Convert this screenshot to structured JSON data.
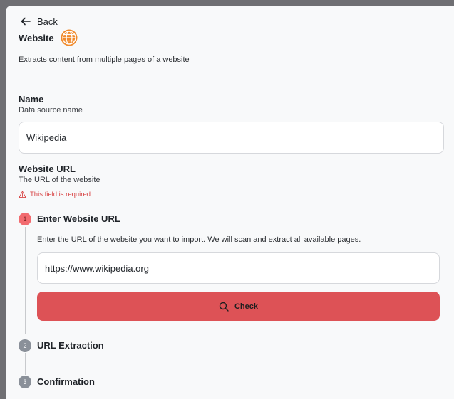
{
  "back_label": "Back",
  "header": {
    "title": "Website",
    "description": "Extracts content from multiple pages of a website"
  },
  "name_field": {
    "label": "Name",
    "sublabel": "Data source name",
    "value": "Wikipedia"
  },
  "url_field": {
    "label": "Website URL",
    "sublabel": "The URL of the website",
    "error": "This field is required"
  },
  "steps": [
    {
      "number": "1",
      "label": "Enter Website URL",
      "description": "Enter the URL of the website you want to import. We will scan and extract all available pages.",
      "input_value": "https://www.wikipedia.org",
      "button_label": "Check"
    },
    {
      "number": "2",
      "label": "URL Extraction"
    },
    {
      "number": "3",
      "label": "Confirmation"
    }
  ],
  "colors": {
    "accent": "#dd5256",
    "active_step": "#f26b6f",
    "inactive_step": "#8a9099",
    "error": "#d84545",
    "globe": "#f08a2c"
  },
  "icons": {
    "back": "arrow-left-icon",
    "website": "globe-icon",
    "error": "warning-triangle-icon",
    "check": "search-icon"
  }
}
